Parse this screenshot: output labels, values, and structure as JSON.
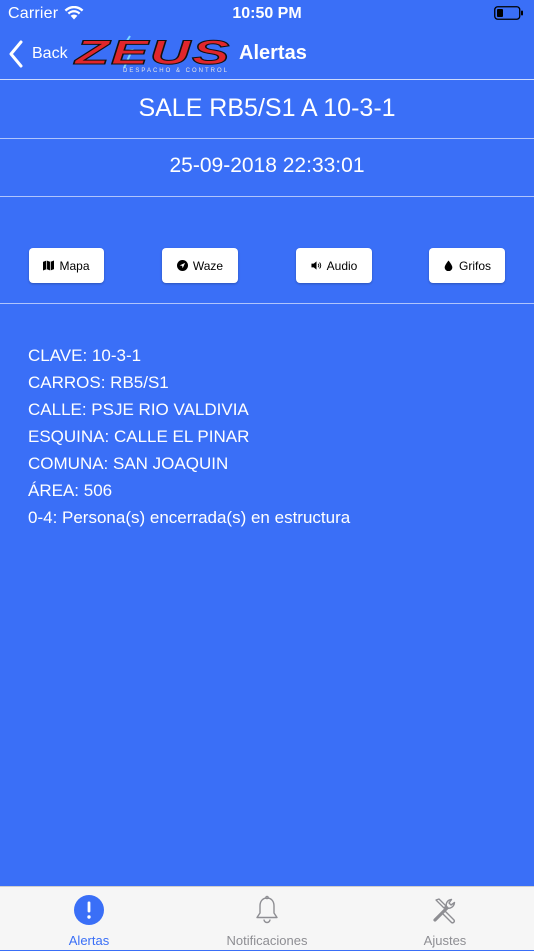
{
  "status_bar": {
    "carrier": "Carrier",
    "time": "10:50 PM"
  },
  "nav": {
    "back_label": "Back",
    "title": "Alertas",
    "logo_text": "ZEUS",
    "logo_subtitle": "DESPACHO & CONTROL"
  },
  "alert": {
    "title": "SALE RB5/S1 A 10-3-1",
    "datetime": "25-09-2018 22:33:01"
  },
  "actions": [
    {
      "label": "Mapa",
      "icon": "map-icon"
    },
    {
      "label": "Waze",
      "icon": "navigation-arrow-icon"
    },
    {
      "label": "Audio",
      "icon": "speaker-icon"
    },
    {
      "label": "Grifos",
      "icon": "water-drop-icon"
    }
  ],
  "details": [
    "CLAVE: 10-3-1",
    "CARROS: RB5/S1",
    "CALLE: PSJE RIO VALDIVIA",
    "ESQUINA: CALLE EL PINAR",
    "COMUNA: SAN JOAQUIN",
    "ÁREA: 506",
    "0-4: Persona(s) encerrada(s) en estructura"
  ],
  "tabs": [
    {
      "label": "Alertas",
      "icon": "exclamation-circle-icon",
      "active": true
    },
    {
      "label": "Notificaciones",
      "icon": "bell-icon",
      "active": false
    },
    {
      "label": "Ajustes",
      "icon": "tools-icon",
      "active": false
    }
  ],
  "colors": {
    "background": "#3a6ff7",
    "tab_active": "#3a6ff7",
    "tab_inactive": "#8e8e93",
    "logo_red": "#e0262b"
  }
}
